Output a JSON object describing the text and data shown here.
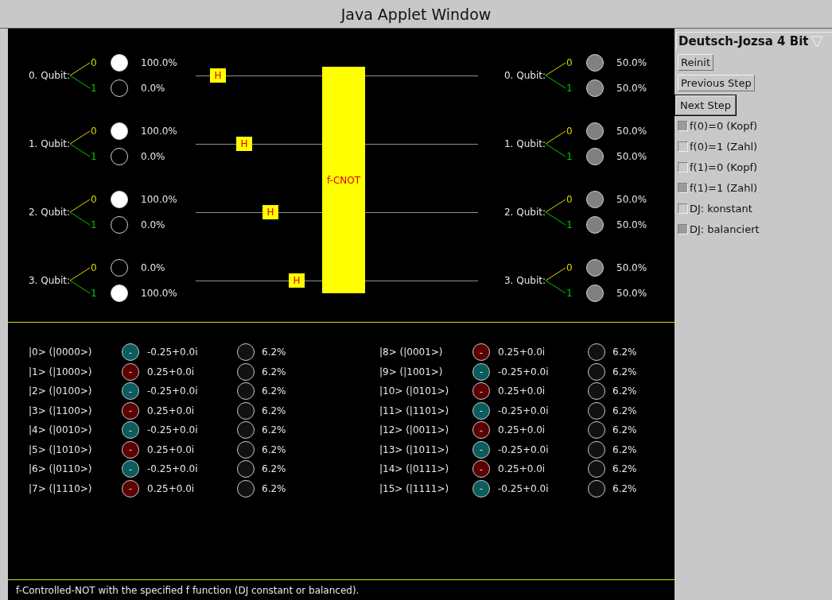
{
  "window": {
    "title": "Java Applet Window"
  },
  "circuit": {
    "input_qubits": [
      {
        "label": "0. Qubit:",
        "states": [
          {
            "label": "0",
            "color": "#d8d800",
            "kind": "full",
            "percent": "100.0%"
          },
          {
            "label": "1",
            "color": "#00c800",
            "kind": "empty",
            "percent": "0.0%"
          }
        ]
      },
      {
        "label": "1. Qubit:",
        "states": [
          {
            "label": "0",
            "color": "#d8d800",
            "kind": "full",
            "percent": "100.0%"
          },
          {
            "label": "1",
            "color": "#00c800",
            "kind": "empty",
            "percent": "0.0%"
          }
        ]
      },
      {
        "label": "2. Qubit:",
        "states": [
          {
            "label": "0",
            "color": "#d8d800",
            "kind": "full",
            "percent": "100.0%"
          },
          {
            "label": "1",
            "color": "#00c800",
            "kind": "empty",
            "percent": "0.0%"
          }
        ]
      },
      {
        "label": "3. Qubit:",
        "states": [
          {
            "label": "0",
            "color": "#d8d800",
            "kind": "empty",
            "percent": "0.0%"
          },
          {
            "label": "1",
            "color": "#00c800",
            "kind": "full",
            "percent": "100.0%"
          }
        ]
      }
    ],
    "gates": [
      {
        "label": "H"
      },
      {
        "label": "H"
      },
      {
        "label": "H"
      },
      {
        "label": "H"
      }
    ],
    "oracle": {
      "label": "f-CNOT"
    },
    "output_qubits": [
      {
        "label": "0. Qubit:",
        "states": [
          {
            "label": "0",
            "color": "#d8d800",
            "kind": "half",
            "percent": "50.0%"
          },
          {
            "label": "1",
            "color": "#00c800",
            "kind": "half",
            "percent": "50.0%"
          }
        ]
      },
      {
        "label": "1. Qubit:",
        "states": [
          {
            "label": "0",
            "color": "#d8d800",
            "kind": "half",
            "percent": "50.0%"
          },
          {
            "label": "1",
            "color": "#00c800",
            "kind": "half",
            "percent": "50.0%"
          }
        ]
      },
      {
        "label": "2. Qubit:",
        "states": [
          {
            "label": "0",
            "color": "#d8d800",
            "kind": "half",
            "percent": "50.0%"
          },
          {
            "label": "1",
            "color": "#00c800",
            "kind": "half",
            "percent": "50.0%"
          }
        ]
      },
      {
        "label": "3. Qubit:",
        "states": [
          {
            "label": "0",
            "color": "#d8d800",
            "kind": "half",
            "percent": "50.0%"
          },
          {
            "label": "1",
            "color": "#00c800",
            "kind": "half",
            "percent": "50.0%"
          }
        ]
      }
    ]
  },
  "amplitudes": [
    {
      "basis": "|0> (|0000>)",
      "sign": "-",
      "color": "#0b5c5c",
      "amplitude": "-0.25+0.0i",
      "probability": "6.2%"
    },
    {
      "basis": "|1> (|1000>)",
      "sign": "-",
      "color": "#5c0000",
      "amplitude": "0.25+0.0i",
      "probability": "6.2%"
    },
    {
      "basis": "|2> (|0100>)",
      "sign": "-",
      "color": "#0b5c5c",
      "amplitude": "-0.25+0.0i",
      "probability": "6.2%"
    },
    {
      "basis": "|3> (|1100>)",
      "sign": "-",
      "color": "#5c0000",
      "amplitude": "0.25+0.0i",
      "probability": "6.2%"
    },
    {
      "basis": "|4> (|0010>)",
      "sign": "-",
      "color": "#0b5c5c",
      "amplitude": "-0.25+0.0i",
      "probability": "6.2%"
    },
    {
      "basis": "|5> (|1010>)",
      "sign": "-",
      "color": "#5c0000",
      "amplitude": "0.25+0.0i",
      "probability": "6.2%"
    },
    {
      "basis": "|6> (|0110>)",
      "sign": "-",
      "color": "#0b5c5c",
      "amplitude": "-0.25+0.0i",
      "probability": "6.2%"
    },
    {
      "basis": "|7> (|1110>)",
      "sign": "-",
      "color": "#5c0000",
      "amplitude": "0.25+0.0i",
      "probability": "6.2%"
    },
    {
      "basis": "|8> (|0001>)",
      "sign": "-",
      "color": "#5c0000",
      "amplitude": "0.25+0.0i",
      "probability": "6.2%"
    },
    {
      "basis": "|9> (|1001>)",
      "sign": "-",
      "color": "#0b5c5c",
      "amplitude": "-0.25+0.0i",
      "probability": "6.2%"
    },
    {
      "basis": "|10> (|0101>)",
      "sign": "-",
      "color": "#5c0000",
      "amplitude": "0.25+0.0i",
      "probability": "6.2%"
    },
    {
      "basis": "|11> (|1101>)",
      "sign": "-",
      "color": "#0b5c5c",
      "amplitude": "-0.25+0.0i",
      "probability": "6.2%"
    },
    {
      "basis": "|12> (|0011>)",
      "sign": "-",
      "color": "#5c0000",
      "amplitude": "0.25+0.0i",
      "probability": "6.2%"
    },
    {
      "basis": "|13> (|1011>)",
      "sign": "-",
      "color": "#0b5c5c",
      "amplitude": "-0.25+0.0i",
      "probability": "6.2%"
    },
    {
      "basis": "|14> (|0111>)",
      "sign": "-",
      "color": "#5c0000",
      "amplitude": "0.25+0.0i",
      "probability": "6.2%"
    },
    {
      "basis": "|15> (|1111>)",
      "sign": "-",
      "color": "#0b5c5c",
      "amplitude": "-0.25+0.0i",
      "probability": "6.2%"
    }
  ],
  "status_bar": "f-Controlled-NOT with the specified f function (DJ constant or balanced).",
  "controls": {
    "algorithm": "Deutsch-Jozsa 4 Bit",
    "buttons": [
      {
        "label": "Reinit",
        "focused": false
      },
      {
        "label": "Previous Step",
        "focused": false
      },
      {
        "label": "Next Step",
        "focused": true
      }
    ],
    "options": [
      {
        "label": "f(0)=0 (Kopf)",
        "checked": true
      },
      {
        "label": "f(0)=1 (Zahl)",
        "checked": false
      },
      {
        "label": "f(1)=0 (Kopf)",
        "checked": false
      },
      {
        "label": "f(1)=1 (Zahl)",
        "checked": true
      },
      {
        "label": "DJ: konstant",
        "checked": false
      },
      {
        "label": "DJ: balanciert",
        "checked": true
      }
    ]
  }
}
